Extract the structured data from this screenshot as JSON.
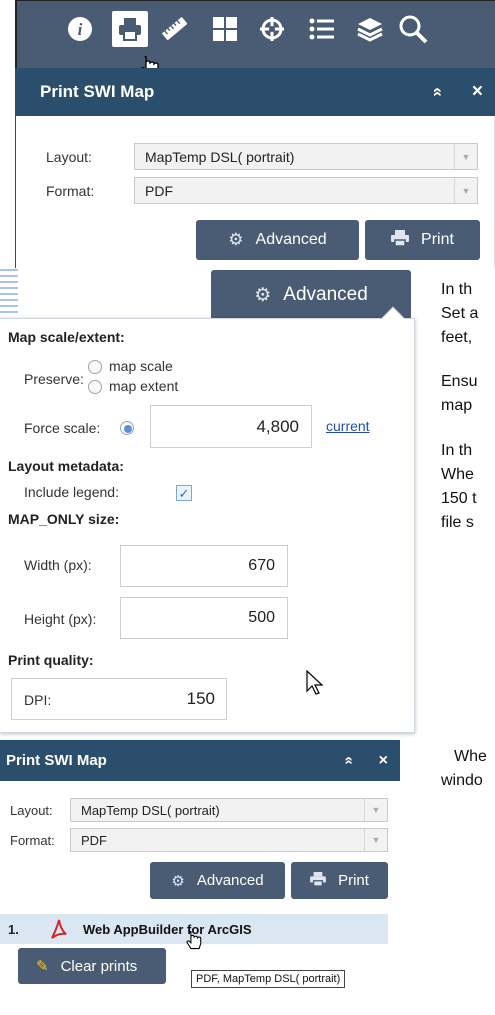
{
  "toolbar": {
    "icons": [
      "info-icon",
      "print-icon",
      "measure-icon",
      "layout-grid-icon",
      "analysis-icon",
      "legend-list-icon",
      "layers-icon",
      "search-icon"
    ]
  },
  "panel_top": {
    "title": "Print SWI Map",
    "collapse_glyph": "»",
    "close_glyph": "×",
    "layout_label": "Layout:",
    "layout_value": "MapTemp DSL( portrait)",
    "format_label": "Format:",
    "format_value": "PDF",
    "advanced_label": "Advanced",
    "print_label": "Print"
  },
  "advanced_button": {
    "label": "Advanced"
  },
  "advanced_popup": {
    "map_scale_extent_heading": "Map scale/extent:",
    "preserve_label": "Preserve:",
    "map_scale_option": "map scale",
    "map_extent_option": "map extent",
    "force_scale_label": "Force scale:",
    "force_scale_value": "4,800",
    "current_link": "current",
    "layout_metadata_heading": "Layout metadata:",
    "include_legend_label": "Include legend:",
    "include_legend_checked": true,
    "map_only_size_heading": "MAP_ONLY size:",
    "width_label": "Width (px):",
    "width_value": "670",
    "height_label": "Height (px):",
    "height_value": "500",
    "print_quality_heading": "Print quality:",
    "dpi_label": "DPI:",
    "dpi_value": "150"
  },
  "notes": {
    "n1": "In th",
    "n2": "Set a",
    "n3": "feet,",
    "n4": "Ensu",
    "n5": "map",
    "n6": "In th",
    "n7": "Whe",
    "n8": "150 t",
    "n9": "file s",
    "n10": "Whe",
    "n11": "windo"
  },
  "panel_bottom": {
    "title": "Print SWI Map",
    "collapse_glyph": "»",
    "close_glyph": "×",
    "layout_label": "Layout:",
    "layout_value": "MapTemp DSL( portrait)",
    "format_label": "Format:",
    "format_value": "PDF",
    "advanced_label": "Advanced",
    "print_label": "Print",
    "result_index": "1.",
    "result_title": "Web AppBuilder for ArcGIS",
    "clear_label": "Clear prints",
    "tooltip": "PDF, MapTemp DSL( portrait)"
  },
  "colors": {
    "toolbar_bg": "#4a5c74",
    "panel_header_bg": "#2a4e6b",
    "button_bg": "#4a5c74",
    "link": "#1f4fb4",
    "highlight_row": "#dbe6f3"
  }
}
